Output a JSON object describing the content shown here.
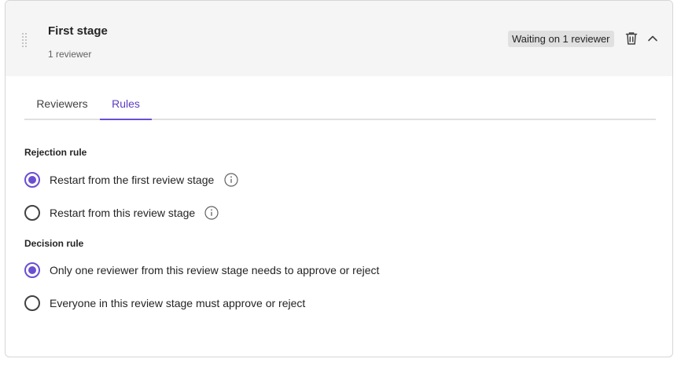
{
  "stage": {
    "title": "First stage",
    "subtitle": "1 reviewer",
    "status_badge": "Waiting on 1 reviewer"
  },
  "icons": {
    "drag": "drag-handle-icon",
    "delete": "trash-icon",
    "collapse": "chevron-up-icon",
    "info": "info-icon"
  },
  "tabs": [
    {
      "label": "Reviewers",
      "selected": false
    },
    {
      "label": "Rules",
      "selected": true
    }
  ],
  "rejection_rule": {
    "label": "Rejection rule",
    "options": [
      {
        "label": "Restart from the first review stage",
        "checked": true
      },
      {
        "label": "Restart from this review stage",
        "checked": false
      }
    ]
  },
  "decision_rule": {
    "label": "Decision rule",
    "options": [
      {
        "label": "Only one reviewer from this review stage needs to approve or reject",
        "checked": true
      },
      {
        "label": "Everyone in this review stage must approve or reject",
        "checked": false
      }
    ]
  },
  "colors": {
    "accent": "#6b4fd1",
    "header_bg": "#f5f5f5",
    "badge_bg": "#e0e0e0"
  }
}
